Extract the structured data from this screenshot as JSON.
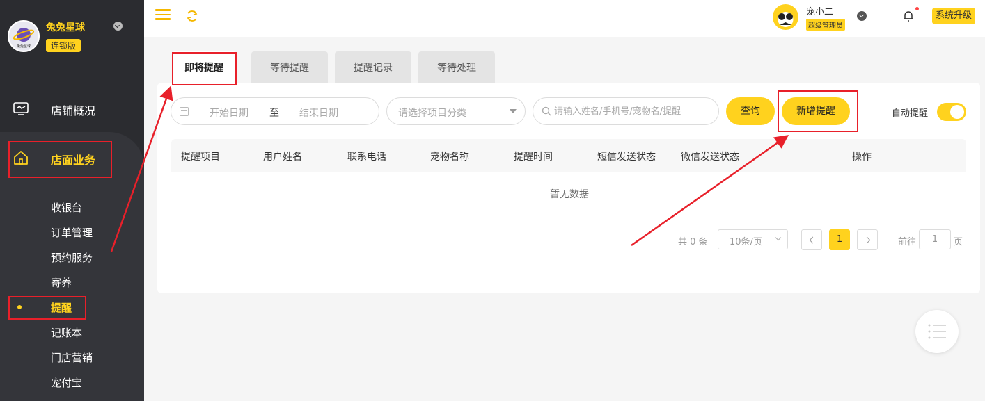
{
  "sidebar": {
    "brand_name": "兔兔星球",
    "brand_badge": "连锁版",
    "logo_text": "兔兔星球",
    "nav": [
      {
        "label": "店铺概况",
        "icon": "monitor-icon"
      },
      {
        "label": "店面业务",
        "icon": "home-icon"
      }
    ],
    "sub_items": [
      "收银台",
      "订单管理",
      "预约服务",
      "寄养",
      "提醒",
      "记账本",
      "门店营销",
      "宠付宝"
    ],
    "active_sub": "提醒"
  },
  "topbar": {
    "user_name": "宠小二",
    "user_role": "超级管理员",
    "upgrade_label": "系统升级"
  },
  "tabs": [
    {
      "label": "即将提醒",
      "active": true
    },
    {
      "label": "等待提醒",
      "active": false
    },
    {
      "label": "提醒记录",
      "active": false
    },
    {
      "label": "等待处理",
      "active": false
    }
  ],
  "filters": {
    "start_date_placeholder": "开始日期",
    "date_separator": "至",
    "end_date_placeholder": "结束日期",
    "category_placeholder": "请选择项目分类",
    "search_placeholder": "请输入姓名/手机号/宠物名/提醒",
    "query_label": "查询",
    "add_label": "新增提醒",
    "auto_remind_label": "自动提醒",
    "auto_remind_on": true
  },
  "table": {
    "columns": [
      "提醒项目",
      "用户姓名",
      "联系电话",
      "宠物名称",
      "提醒时间",
      "短信发送状态",
      "微信发送状态",
      "操作"
    ],
    "empty_text": "暂无数据"
  },
  "pagination": {
    "total": "共 0 条",
    "page_size": "10条/页",
    "current_page": "1",
    "goto_label": "前往",
    "goto_value": "1",
    "page_suffix": "页"
  },
  "colors": {
    "accent": "#ffd21e",
    "sidebar_bg": "#2b2c30",
    "annotation": "#e8202a"
  }
}
